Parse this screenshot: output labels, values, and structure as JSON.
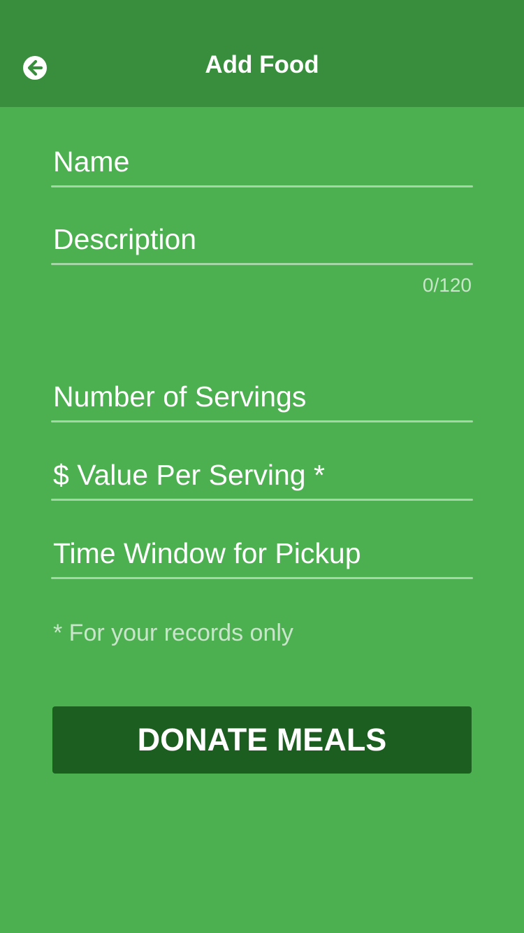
{
  "header": {
    "title": "Add Food",
    "back_icon": "arrow-left-circle-icon"
  },
  "form": {
    "fields": [
      {
        "label": "Name"
      },
      {
        "label": "Description"
      },
      {
        "label": "Number of Servings"
      },
      {
        "label": "$ Value Per Serving *"
      },
      {
        "label": "Time Window for Pickup"
      }
    ],
    "description_counter": "0/120",
    "records_note": "* For your records only",
    "submit_label": "DONATE MEALS"
  },
  "colors": {
    "app_bar": "#388e3c",
    "background": "#4caf50",
    "button": "#1b5e20",
    "underline": "#a5d6a7",
    "muted_text": "#c8e6c9"
  }
}
